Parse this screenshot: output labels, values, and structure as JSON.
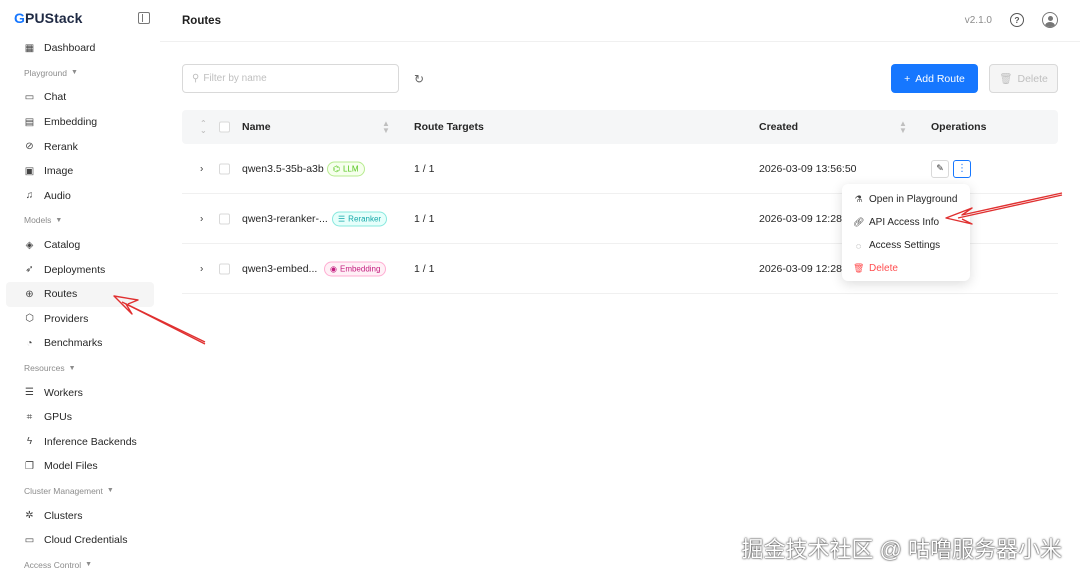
{
  "app": {
    "logo_g": "G",
    "logo_rest": "PUStack"
  },
  "header": {
    "title": "Routes",
    "version": "v2.1.0"
  },
  "sidebar": {
    "items": [
      {
        "label": "Dashboard",
        "icon": "dashboard-icon"
      },
      {
        "label": "Playground",
        "group": true
      },
      {
        "label": "Chat",
        "icon": "chat-icon"
      },
      {
        "label": "Embedding",
        "icon": "embedding-icon"
      },
      {
        "label": "Rerank",
        "icon": "rerank-icon"
      },
      {
        "label": "Image",
        "icon": "image-icon"
      },
      {
        "label": "Audio",
        "icon": "audio-icon"
      },
      {
        "label": "Models",
        "group": true
      },
      {
        "label": "Catalog",
        "icon": "catalog-icon"
      },
      {
        "label": "Deployments",
        "icon": "rocket-icon"
      },
      {
        "label": "Routes",
        "icon": "routes-icon",
        "active": true
      },
      {
        "label": "Providers",
        "icon": "providers-icon"
      },
      {
        "label": "Benchmarks",
        "icon": "gauge-icon"
      },
      {
        "label": "Resources",
        "group": true
      },
      {
        "label": "Workers",
        "icon": "workers-icon"
      },
      {
        "label": "GPUs",
        "icon": "gpu-icon"
      },
      {
        "label": "Inference Backends",
        "icon": "bolt-icon"
      },
      {
        "label": "Model Files",
        "icon": "files-icon"
      },
      {
        "label": "Cluster Management",
        "group": true
      },
      {
        "label": "Clusters",
        "icon": "clusters-icon"
      },
      {
        "label": "Cloud Credentials",
        "icon": "credentials-icon"
      },
      {
        "label": "Access Control",
        "group": true
      }
    ]
  },
  "toolbar": {
    "search_placeholder": "Filter by name",
    "add_label": "Add Route",
    "delete_label": "Delete"
  },
  "table": {
    "columns": [
      "Name",
      "Route Targets",
      "Created",
      "Operations"
    ],
    "rows": [
      {
        "name": "qwen3.5-35b-a3b",
        "tag": "LLM",
        "tag_type": "llm",
        "targets": "1 / 1",
        "created": "2026-03-09 13:56:50"
      },
      {
        "name": "qwen3-reranker-...",
        "tag": "Reranker",
        "tag_type": "reranker",
        "targets": "1 / 1",
        "created": "2026-03-09 12:28:"
      },
      {
        "name": "qwen3-embed...",
        "tag": "Embedding",
        "tag_type": "embedding",
        "targets": "1 / 1",
        "created": "2026-03-09 12:28:"
      }
    ]
  },
  "dropdown": {
    "items": [
      {
        "label": "Open in Playground",
        "icon": "flask-icon"
      },
      {
        "label": "API Access Info",
        "icon": "link-icon"
      },
      {
        "label": "Access Settings",
        "icon": "settings-icon"
      },
      {
        "label": "Delete",
        "icon": "trash-icon",
        "danger": true
      }
    ]
  },
  "colors": {
    "primary": "#1677ff",
    "danger": "#ff4d4f",
    "annotation_arrow": "#e03030"
  },
  "watermark": "掘金技术社区 @ 咕噜服务器小米"
}
